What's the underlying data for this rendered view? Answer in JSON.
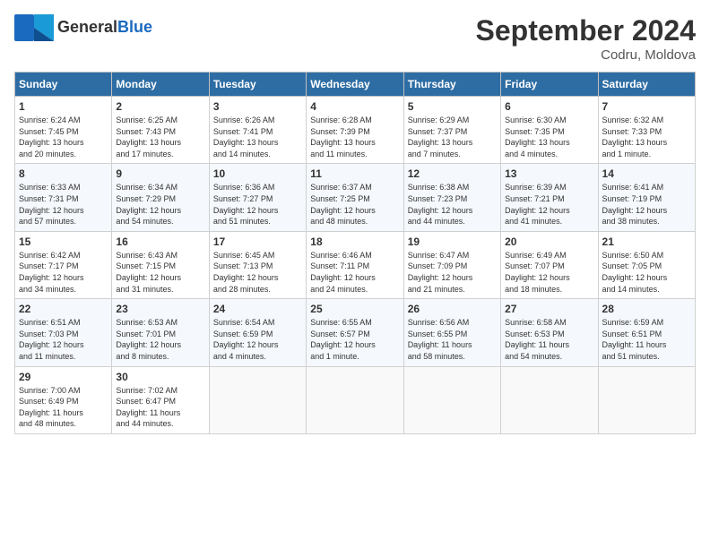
{
  "header": {
    "logo_line1": "General",
    "logo_line2": "Blue",
    "month_title": "September 2024",
    "location": "Codru, Moldova"
  },
  "days_of_week": [
    "Sunday",
    "Monday",
    "Tuesday",
    "Wednesday",
    "Thursday",
    "Friday",
    "Saturday"
  ],
  "weeks": [
    [
      {
        "day": "1",
        "info": "Sunrise: 6:24 AM\nSunset: 7:45 PM\nDaylight: 13 hours\nand 20 minutes."
      },
      {
        "day": "2",
        "info": "Sunrise: 6:25 AM\nSunset: 7:43 PM\nDaylight: 13 hours\nand 17 minutes."
      },
      {
        "day": "3",
        "info": "Sunrise: 6:26 AM\nSunset: 7:41 PM\nDaylight: 13 hours\nand 14 minutes."
      },
      {
        "day": "4",
        "info": "Sunrise: 6:28 AM\nSunset: 7:39 PM\nDaylight: 13 hours\nand 11 minutes."
      },
      {
        "day": "5",
        "info": "Sunrise: 6:29 AM\nSunset: 7:37 PM\nDaylight: 13 hours\nand 7 minutes."
      },
      {
        "day": "6",
        "info": "Sunrise: 6:30 AM\nSunset: 7:35 PM\nDaylight: 13 hours\nand 4 minutes."
      },
      {
        "day": "7",
        "info": "Sunrise: 6:32 AM\nSunset: 7:33 PM\nDaylight: 13 hours\nand 1 minute."
      }
    ],
    [
      {
        "day": "8",
        "info": "Sunrise: 6:33 AM\nSunset: 7:31 PM\nDaylight: 12 hours\nand 57 minutes."
      },
      {
        "day": "9",
        "info": "Sunrise: 6:34 AM\nSunset: 7:29 PM\nDaylight: 12 hours\nand 54 minutes."
      },
      {
        "day": "10",
        "info": "Sunrise: 6:36 AM\nSunset: 7:27 PM\nDaylight: 12 hours\nand 51 minutes."
      },
      {
        "day": "11",
        "info": "Sunrise: 6:37 AM\nSunset: 7:25 PM\nDaylight: 12 hours\nand 48 minutes."
      },
      {
        "day": "12",
        "info": "Sunrise: 6:38 AM\nSunset: 7:23 PM\nDaylight: 12 hours\nand 44 minutes."
      },
      {
        "day": "13",
        "info": "Sunrise: 6:39 AM\nSunset: 7:21 PM\nDaylight: 12 hours\nand 41 minutes."
      },
      {
        "day": "14",
        "info": "Sunrise: 6:41 AM\nSunset: 7:19 PM\nDaylight: 12 hours\nand 38 minutes."
      }
    ],
    [
      {
        "day": "15",
        "info": "Sunrise: 6:42 AM\nSunset: 7:17 PM\nDaylight: 12 hours\nand 34 minutes."
      },
      {
        "day": "16",
        "info": "Sunrise: 6:43 AM\nSunset: 7:15 PM\nDaylight: 12 hours\nand 31 minutes."
      },
      {
        "day": "17",
        "info": "Sunrise: 6:45 AM\nSunset: 7:13 PM\nDaylight: 12 hours\nand 28 minutes."
      },
      {
        "day": "18",
        "info": "Sunrise: 6:46 AM\nSunset: 7:11 PM\nDaylight: 12 hours\nand 24 minutes."
      },
      {
        "day": "19",
        "info": "Sunrise: 6:47 AM\nSunset: 7:09 PM\nDaylight: 12 hours\nand 21 minutes."
      },
      {
        "day": "20",
        "info": "Sunrise: 6:49 AM\nSunset: 7:07 PM\nDaylight: 12 hours\nand 18 minutes."
      },
      {
        "day": "21",
        "info": "Sunrise: 6:50 AM\nSunset: 7:05 PM\nDaylight: 12 hours\nand 14 minutes."
      }
    ],
    [
      {
        "day": "22",
        "info": "Sunrise: 6:51 AM\nSunset: 7:03 PM\nDaylight: 12 hours\nand 11 minutes."
      },
      {
        "day": "23",
        "info": "Sunrise: 6:53 AM\nSunset: 7:01 PM\nDaylight: 12 hours\nand 8 minutes."
      },
      {
        "day": "24",
        "info": "Sunrise: 6:54 AM\nSunset: 6:59 PM\nDaylight: 12 hours\nand 4 minutes."
      },
      {
        "day": "25",
        "info": "Sunrise: 6:55 AM\nSunset: 6:57 PM\nDaylight: 12 hours\nand 1 minute."
      },
      {
        "day": "26",
        "info": "Sunrise: 6:56 AM\nSunset: 6:55 PM\nDaylight: 11 hours\nand 58 minutes."
      },
      {
        "day": "27",
        "info": "Sunrise: 6:58 AM\nSunset: 6:53 PM\nDaylight: 11 hours\nand 54 minutes."
      },
      {
        "day": "28",
        "info": "Sunrise: 6:59 AM\nSunset: 6:51 PM\nDaylight: 11 hours\nand 51 minutes."
      }
    ],
    [
      {
        "day": "29",
        "info": "Sunrise: 7:00 AM\nSunset: 6:49 PM\nDaylight: 11 hours\nand 48 minutes."
      },
      {
        "day": "30",
        "info": "Sunrise: 7:02 AM\nSunset: 6:47 PM\nDaylight: 11 hours\nand 44 minutes."
      },
      {
        "day": "",
        "info": ""
      },
      {
        "day": "",
        "info": ""
      },
      {
        "day": "",
        "info": ""
      },
      {
        "day": "",
        "info": ""
      },
      {
        "day": "",
        "info": ""
      }
    ]
  ]
}
